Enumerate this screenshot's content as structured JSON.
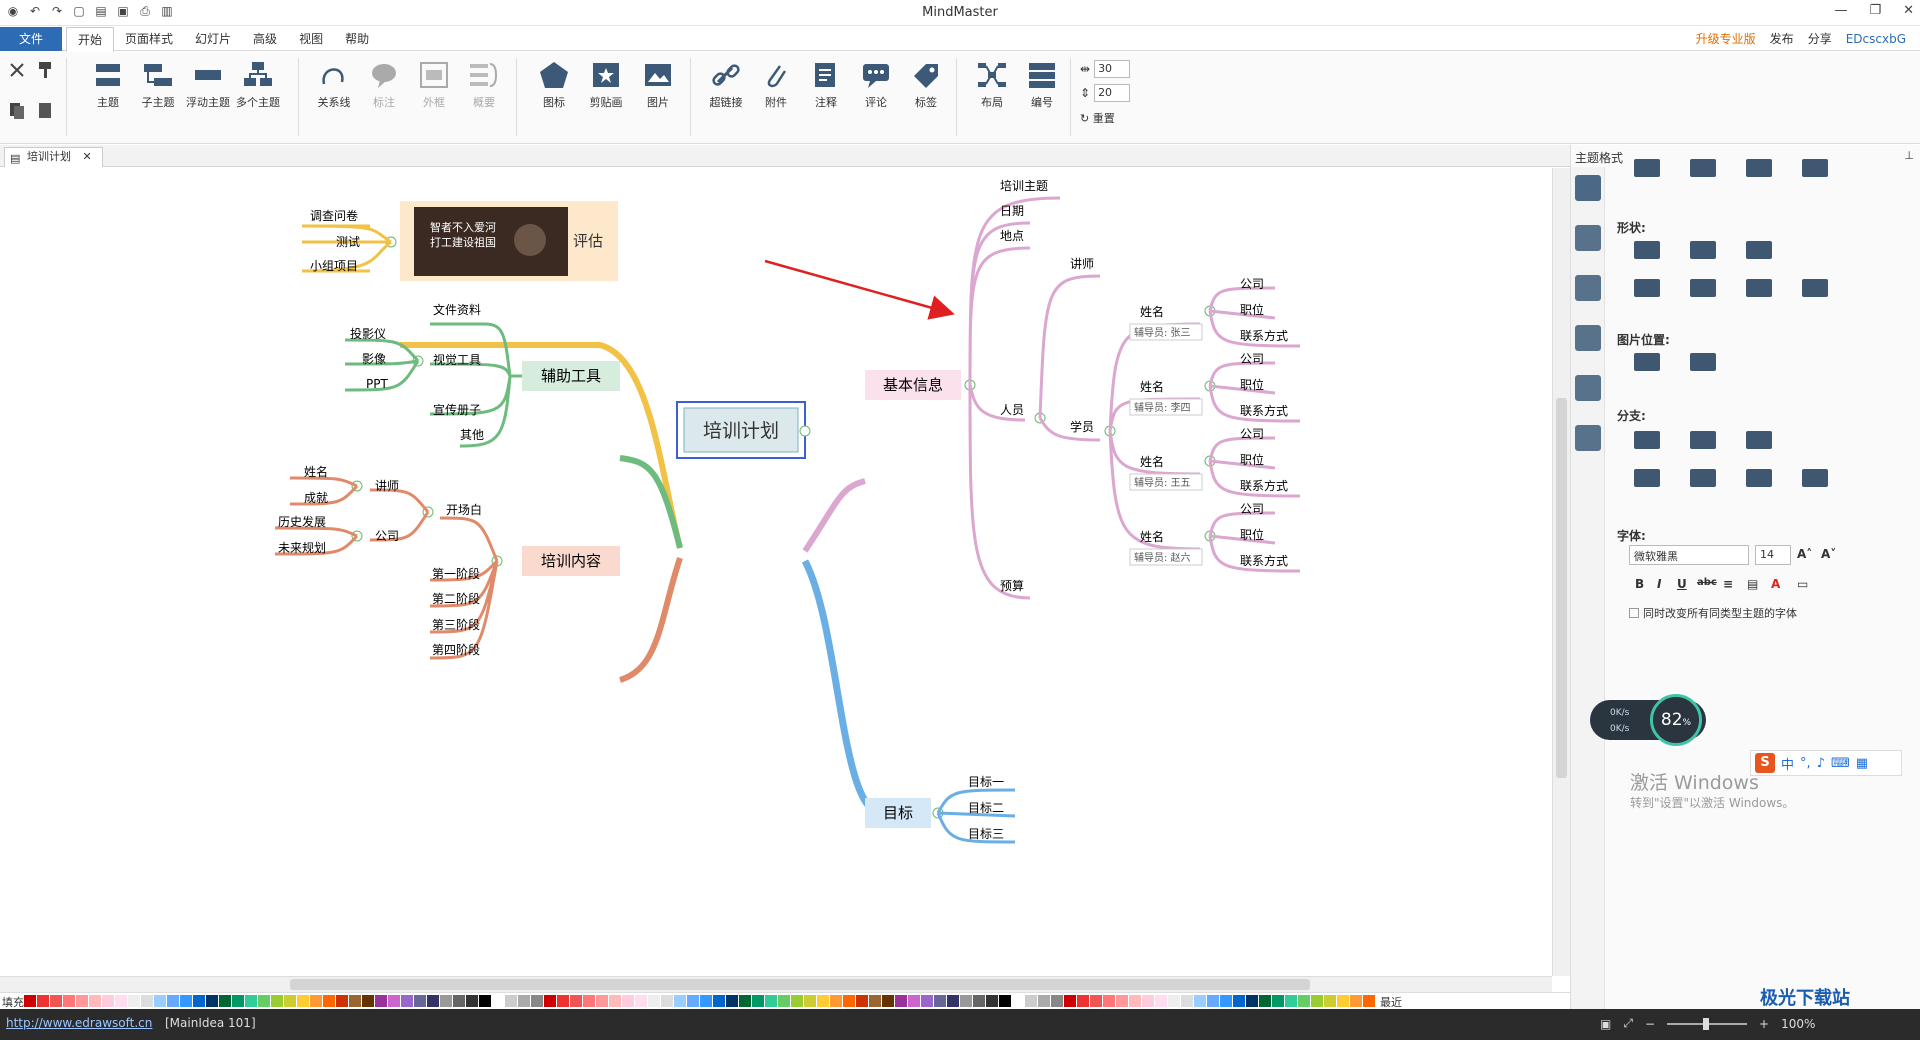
{
  "titlebar": {
    "title": "MindMaster"
  },
  "menubar": {
    "file": "文件",
    "menus": [
      "开始",
      "页面样式",
      "幻灯片",
      "高级",
      "视图",
      "帮助"
    ],
    "active": "开始",
    "upgrade": "升级专业版",
    "publish": "发布",
    "share": "分享",
    "user": "EDcscxbG"
  },
  "ribbon": {
    "topic": "主题",
    "subtopic": "子主题",
    "floating": "浮动主题",
    "multi": "多个主题",
    "relation": "关系线",
    "callout": "标注",
    "boundary": "外框",
    "summary": "概要",
    "icon": "图标",
    "clipart": "剪贴画",
    "picture": "图片",
    "hyperlink": "超链接",
    "attachment": "附件",
    "note": "注释",
    "comment": "评论",
    "tag": "标签",
    "layout": "布局",
    "numbering": "编号",
    "reset": "重置",
    "spacing_h": "30",
    "spacing_v": "20"
  },
  "doc_tab": {
    "label": "培训计划"
  },
  "mindmap": {
    "central": "培训计划",
    "eval": {
      "label": "评估",
      "children": [
        "调查问卷",
        "测试",
        "小组项目"
      ],
      "image_text": [
        "智者不入爱河",
        "打工建设祖国"
      ]
    },
    "tools": {
      "label": "辅助工具",
      "children": [
        "文件资料",
        "视觉工具",
        "宣传册子",
        "其他"
      ],
      "visual": [
        "投影仪",
        "影像",
        "PPT"
      ]
    },
    "content": {
      "label": "培训内容",
      "opening": "开场白",
      "lecturer": "讲师",
      "lecturer_children": [
        "姓名",
        "成就"
      ],
      "company": "公司",
      "company_children": [
        "历史发展",
        "未来规划"
      ],
      "stages": [
        "第一阶段",
        "第二阶段",
        "第三阶段",
        "第四阶段"
      ]
    },
    "basic": {
      "label": "基本信息",
      "items": [
        "培训主题",
        "日期",
        "地点",
        "预算"
      ],
      "people": "人员",
      "lecturer": "讲师",
      "students": "学员",
      "name": "姓名",
      "fields": [
        "公司",
        "职位",
        "联系方式"
      ],
      "assistants": [
        "辅导员: 张三",
        "辅导员: 李四",
        "辅导员: 王五",
        "辅导员: 赵六"
      ]
    },
    "goal": {
      "label": "目标",
      "children": [
        "目标一",
        "目标二",
        "目标三"
      ]
    }
  },
  "panel": {
    "title": "主题格式",
    "shape": "形状:",
    "image_pos": "图片位置:",
    "branch": "分支:",
    "font": "字体:",
    "font_family": "微软雅黑",
    "font_size": "14",
    "same_type": "同时改变所有同类型主题的字体"
  },
  "colorbar": {
    "fill": "填充",
    "recent": "最近"
  },
  "status": {
    "url": "http://www.edrawsoft.cn",
    "idea": "[MainIdea 101]",
    "zoom": "100%"
  },
  "widgets": {
    "net_up": "0K/s",
    "net_down": "0K/s",
    "cpu": "82",
    "cpu_unit": "%",
    "ime": "中"
  },
  "watermark": {
    "activate": "激活 Windows",
    "activate_sub": "转到\"设置\"以激活 Windows。",
    "site": "极光下载站"
  },
  "colors": {
    "yellow": "#f2c246",
    "green": "#6dbb7d",
    "orange": "#e08a6a",
    "pink": "#dba6cf",
    "blue": "#6aaee6",
    "accent": "#2d6bb5"
  }
}
